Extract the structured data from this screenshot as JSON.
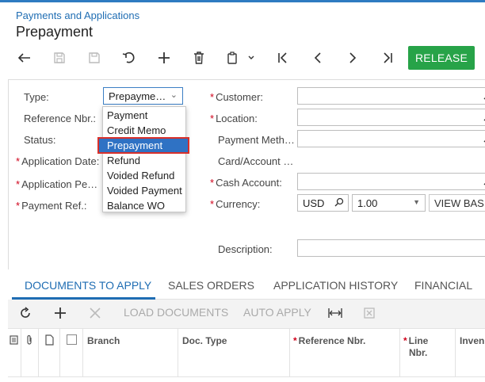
{
  "breadcrumb": "Payments and Applications",
  "page_title": "Prepayment",
  "toolbar": {
    "release_label": "RELEASE"
  },
  "form": {
    "type": {
      "label": "Type:",
      "value": "Prepayme…"
    },
    "reference_nbr": {
      "label": "Reference Nbr.:"
    },
    "status": {
      "label": "Status:"
    },
    "application_date": {
      "label": "Application Date:"
    },
    "application_period": {
      "label": "Application Pe…"
    },
    "payment_ref": {
      "label": "Payment Ref.:"
    },
    "customer": {
      "label": "Customer:"
    },
    "location": {
      "label": "Location:"
    },
    "payment_method": {
      "label": "Payment Meth…"
    },
    "card_account": {
      "label": "Card/Account …"
    },
    "cash_account": {
      "label": "Cash Account:"
    },
    "currency": {
      "label": "Currency:",
      "code": "USD",
      "rate": "1.00",
      "view_base_label": "VIEW BASI"
    },
    "description": {
      "label": "Description:"
    }
  },
  "type_dropdown": {
    "options": [
      "Payment",
      "Credit Memo",
      "Prepayment",
      "Refund",
      "Voided Refund",
      "Voided Payment",
      "Balance WO"
    ],
    "selected": "Prepayment"
  },
  "tabs": [
    "DOCUMENTS TO APPLY",
    "SALES ORDERS",
    "APPLICATION HISTORY",
    "FINANCIAL"
  ],
  "grid_toolbar": {
    "load_documents": "LOAD DOCUMENTS",
    "auto_apply": "AUTO APPLY"
  },
  "grid_columns": {
    "branch": "Branch",
    "doc_type": "Doc. Type",
    "reference_nbr": "Reference Nbr.",
    "line_nbr_1": "Line",
    "line_nbr_2": "Nbr.",
    "inventory": "Inven"
  },
  "colors": {
    "accent": "#1f6db3",
    "release": "#27a348",
    "required": "#d0021b",
    "selected": "#2f72c4"
  }
}
